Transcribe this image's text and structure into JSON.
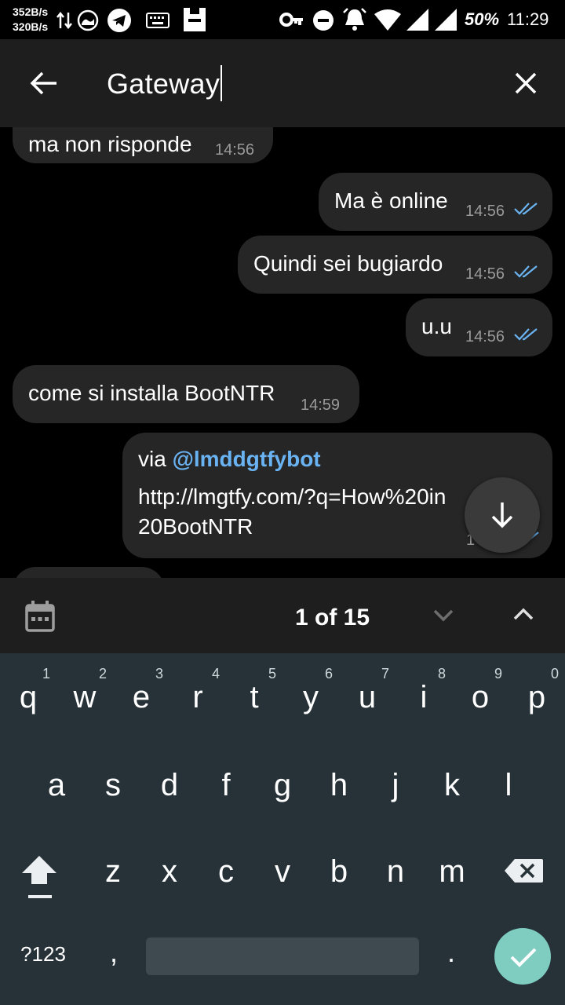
{
  "status_bar": {
    "net_down": "352B/s",
    "net_up": "320B/s",
    "battery": "50%",
    "time": "11:29"
  },
  "header": {
    "search_query": "Gateway"
  },
  "messages": [
    {
      "text": "ma non risponde",
      "time": "14:56",
      "direction": "incoming"
    },
    {
      "text": "Ma è online",
      "time": "14:56",
      "direction": "outgoing"
    },
    {
      "text": "Quindi sei bugiardo",
      "time": "14:56",
      "direction": "outgoing"
    },
    {
      "text": "u.u",
      "time": "14:56",
      "direction": "outgoing"
    },
    {
      "text": "come si installa BootNTR",
      "time": "14:59",
      "direction": "incoming"
    },
    {
      "via_prefix": "via",
      "via_bot": "@lmddgtfybot",
      "link_line1": "http://lmgtfy.com/?q=How%20in",
      "link_line1_tail": "/",
      "link_line2": "20BootNTR",
      "time_partial": "1",
      "direction": "outgoing"
    }
  ],
  "search_nav": {
    "counter": "1 of 15"
  },
  "keyboard": {
    "row1": [
      "q",
      "w",
      "e",
      "r",
      "t",
      "y",
      "u",
      "i",
      "o",
      "p"
    ],
    "row1_hints": [
      "1",
      "2",
      "3",
      "4",
      "5",
      "6",
      "7",
      "8",
      "9",
      "0"
    ],
    "row2": [
      "a",
      "s",
      "d",
      "f",
      "g",
      "h",
      "j",
      "k",
      "l"
    ],
    "row3": [
      "z",
      "x",
      "c",
      "v",
      "b",
      "n",
      "m"
    ],
    "symbols_label": "?123",
    "comma": ",",
    "period": "."
  },
  "colors": {
    "accent_link": "#6ab3f3",
    "bubble": "#262626",
    "keyboard_bg": "#263238",
    "enter_key": "#7ecdc0"
  }
}
